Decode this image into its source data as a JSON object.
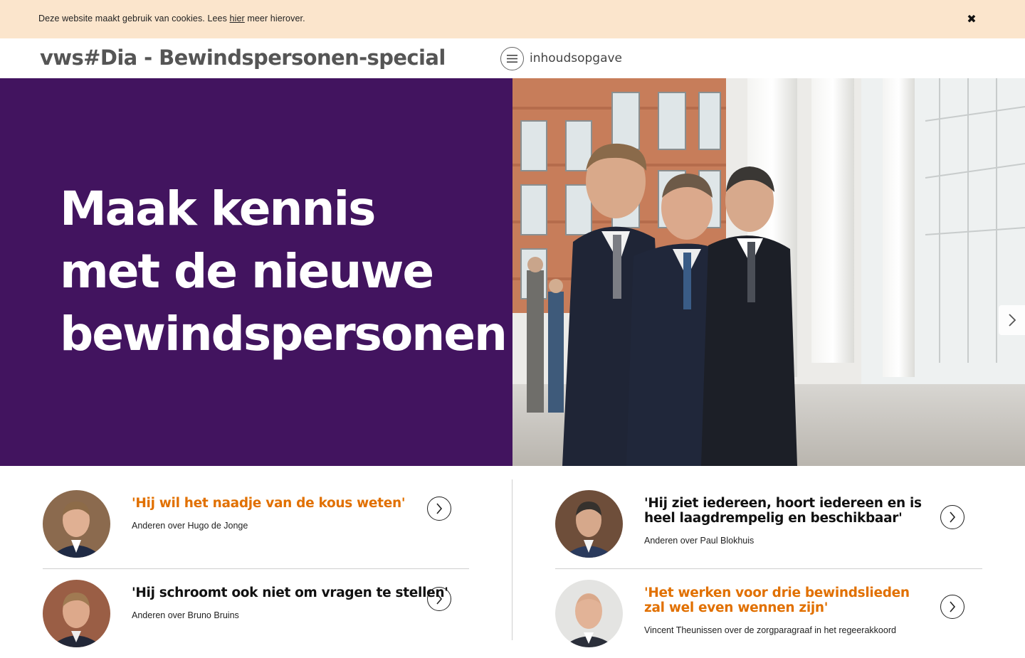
{
  "cookie_bar": {
    "text_before": "Deze website maakt gebruik van cookies. Lees ",
    "link_text": "hier",
    "text_after": " meer hierover.",
    "close_glyph": "✖"
  },
  "header": {
    "title": "vws#Dia - Bewindspersonen-special",
    "toc_label": "inhoudsopgave"
  },
  "hero": {
    "title": "Maak kennis met de nieuwe bewindspersonen",
    "background_color": "#42145f",
    "next_icon": "chevron-right-icon"
  },
  "articles": [
    {
      "title": "'Hij wil het naadje van de kous weten'",
      "subtitle": "Anderen over Hugo de Jonge",
      "title_color": "#e17000"
    },
    {
      "title": "'Hij schroomt ook niet om vragen te stellen'",
      "subtitle": "Anderen over Bruno Bruins",
      "title_color": "#111111"
    },
    {
      "title": "'Hij ziet iedereen, hoort iedereen en is heel laagdrempelig en beschikbaar'",
      "subtitle": "Anderen over Paul Blokhuis",
      "title_color": "#111111"
    },
    {
      "title": "'Het werken voor drie bewindslieden zal wel even wennen zijn'",
      "subtitle": "Vincent Theunissen over de zorgparagraaf in het regeerakkoord",
      "title_color": "#e17000"
    }
  ],
  "colors": {
    "accent_orange": "#e17000",
    "brand_purple": "#42145f",
    "cookie_background": "#fbe5cc"
  }
}
